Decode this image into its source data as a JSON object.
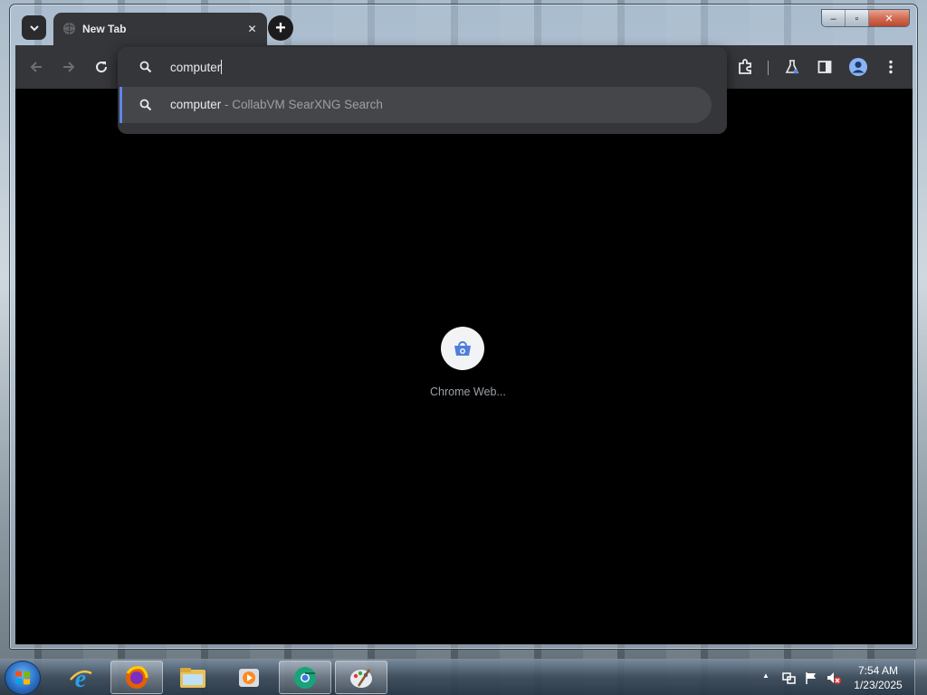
{
  "window": {
    "minimize_glyph": "–",
    "maximize_glyph": "▫",
    "close_glyph": "✕"
  },
  "tab": {
    "title": "New Tab",
    "close_glyph": "✕"
  },
  "new_tab_glyph": "+",
  "omnibox": {
    "typed_text": "computer",
    "suggestion": {
      "query": "computer",
      "separator": " - ",
      "source": "CollabVM SearXNG Search"
    }
  },
  "shortcut": {
    "label": "Chrome Web..."
  },
  "taskbar": {
    "apps": [
      {
        "name": "internet-explorer"
      },
      {
        "name": "firefox"
      },
      {
        "name": "file-explorer"
      },
      {
        "name": "media-player"
      },
      {
        "name": "chrome",
        "active": true
      },
      {
        "name": "paint"
      }
    ],
    "tray_expand_glyph": "▲",
    "time": "7:54 AM",
    "date": "1/23/2025"
  },
  "colors": {
    "chrome_toolbar": "#35363a",
    "content_bg": "#000000",
    "suggestion_accent": "#5e86e6",
    "text_primary": "#e8eaed",
    "text_dim": "#9aa0a6"
  }
}
